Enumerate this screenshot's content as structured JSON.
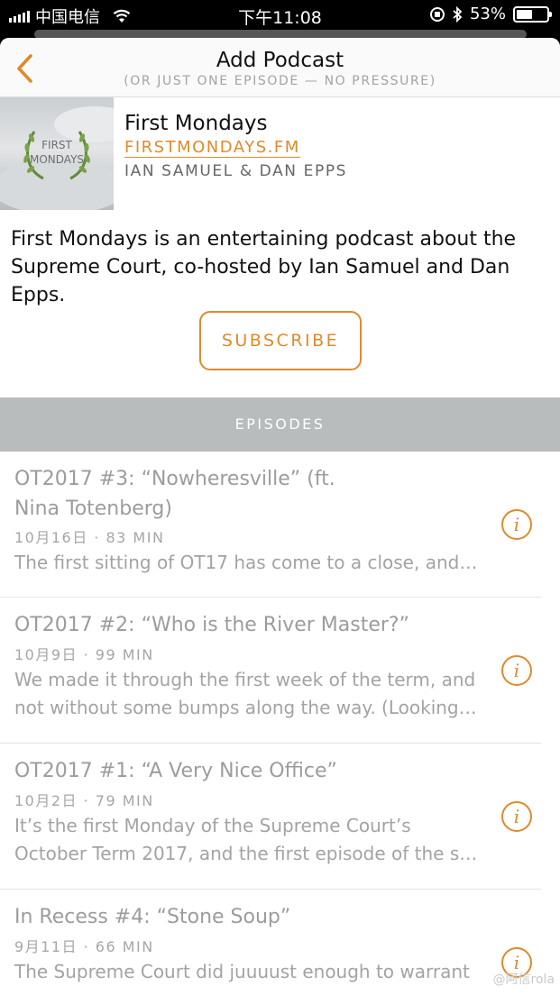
{
  "status_bar": {
    "carrier": "中国电信",
    "time": "下午11:08",
    "battery": "53%",
    "battery_level": 0.53,
    "icons": [
      "signal-icon",
      "wifi-icon",
      "rotation-lock-icon",
      "bluetooth-icon",
      "battery-icon"
    ]
  },
  "nav": {
    "title": "Add Podcast",
    "subtitle": "(OR JUST ONE EPISODE — NO PRESSURE)",
    "back_icon": "chevron-left-icon"
  },
  "podcast": {
    "art_line1": "FIRST",
    "art_line2": "MONDAYS",
    "title": "First Mondays",
    "link": "FIRSTMONDAYS.FM",
    "authors": "IAN SAMUEL & DAN EPPS",
    "description": "First Mondays is an entertaining podcast about the Supreme Court, co-hosted by Ian Samuel and Dan Epps."
  },
  "subscribe_label": "SUBSCRIBE",
  "episodes_header": "EPISODES",
  "episodes": [
    {
      "title": "OT2017 #3: “Nowheresville” (ft. Nina Totenberg)",
      "meta": "10月16日 · 83 MIN",
      "desc": "The first sitting of OT17 has come to a close, and…"
    },
    {
      "title": "OT2017 #2: “Who is the River Master?”",
      "meta": "10月9日 · 99 MIN",
      "desc": "We made it through the first week of the term, and not without some bumps along the way. (Looking…"
    },
    {
      "title": "OT2017 #1: “A Very Nice Office”",
      "meta": "10月2日 · 79 MIN",
      "desc": "It’s the first Monday of the Supreme Court’s October Term 2017, and the first episode of the s…"
    },
    {
      "title": "In Recess #4: “Stone Soup”",
      "meta": "9月11日 · 66 MIN",
      "desc": "The Supreme Court did juuuust enough to warrant"
    }
  ],
  "info_glyph": "i",
  "watermark": "@阿信rola",
  "colors": {
    "accent": "#e08a2b",
    "episodes_bar": "#b8bcbd"
  }
}
